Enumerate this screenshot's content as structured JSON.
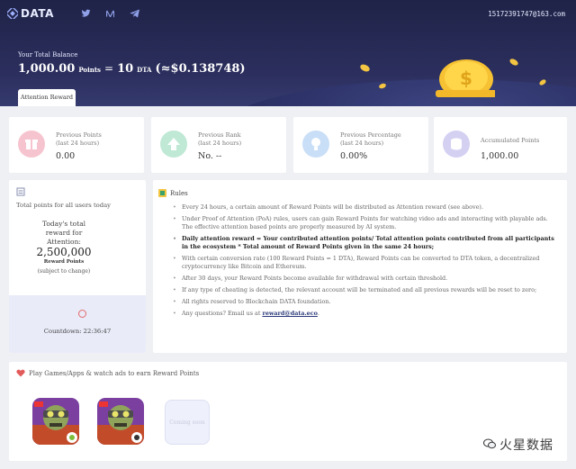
{
  "header": {
    "logo_text": "DATA",
    "social_icons": [
      "twitter-icon",
      "medium-icon",
      "telegram-icon"
    ],
    "phone": "15172391747@163.com",
    "balance_label": "Your Total Balance",
    "balance_points": "1,000.00",
    "points_unit": "Points",
    "equals": "=",
    "dta_amount": "10",
    "dta_unit": "DTA",
    "usd_value": "(≈$0.138748)",
    "tab_label": "Attention Reward"
  },
  "stats": [
    {
      "icon": "gift-icon",
      "label1": "Previous Points",
      "label2": "(last 24 hours)",
      "value": "0.00",
      "color": "#f6c4cf"
    },
    {
      "icon": "rank-up-icon",
      "label1": "Previous Rank",
      "label2": "(last 24 hours)",
      "value": "No. --",
      "color": "#bfe8d5"
    },
    {
      "icon": "lightbulb-icon",
      "label1": "Previous Percentage",
      "label2": "(last 24 hours)",
      "value": "0.00%",
      "color": "#c9def7"
    },
    {
      "icon": "coins-icon",
      "label1": "Accumulated Points",
      "label2": "",
      "value": "1,000.00",
      "color": "#d3d0f2"
    }
  ],
  "total": {
    "title": "Total points for all users today",
    "center_line1": "Today's total",
    "center_line2": "reward for",
    "center_line3": "Attention:",
    "amount": "2,500,000",
    "reward_points": "Reward Points",
    "subject": "(subject to change)",
    "countdown": "Countdown: 22:36:47"
  },
  "rules": {
    "title": "Rules",
    "items": [
      "Every 24 hours, a certain amount of Reward Points will be distributed as Attention reward (see above).",
      "Under Proof of Attention (PoA) rules, users can gain Reward Points for watching video ads and interacting with playable ads. The effective attention based points are properly measured by AI system.",
      "Daily attention reward = Your contributed attention points/ Total attention points contributed from all participants in the ecosystem * Total amount of Reward Points given in the same 24 hours;",
      "With certain conversion rate (100 Reward Points = 1 DTA), Reward Points can be converted to DTA token, a decentralized cryptocurrency like Bitcoin and Ethereum.",
      "After 30 days, your Reward Points become available for withdrawal with certain threshold.",
      "If any type of cheating is detected, the relevant account will be terminated and all previous rewards will be reset to zero;",
      "All rights reserved to Blockchain DATA foundation.",
      "Any questions? Email us at "
    ],
    "email": "reward@data.eco",
    "email_suffix": "."
  },
  "games": {
    "title": "Play Games/Apps & watch ads to earn Reward Points",
    "coming_label": "Coming soon"
  },
  "watermark": {
    "text": "火星数据"
  },
  "colors": {
    "header_bg": "#2c2f5e",
    "accent": "#2b3a7a"
  }
}
